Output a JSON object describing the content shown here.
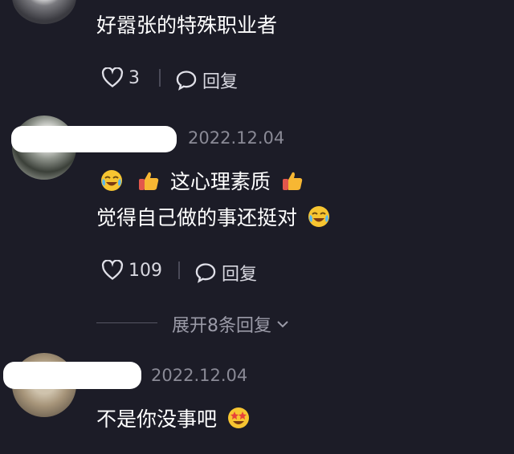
{
  "comments": [
    {
      "text": "好嚣张的特殊职业者",
      "likes": "3",
      "reply_label": "回复"
    },
    {
      "date": "2022.12.04",
      "text_line1": "这心理素质",
      "text_line2": "觉得自己做的事还挺对",
      "likes": "109",
      "reply_label": "回复",
      "expand_label": "展开8条回复"
    },
    {
      "date": "2022.12.04",
      "text": "不是你没事吧"
    }
  ],
  "icons": {
    "like": "heart-outline-icon",
    "reply": "speech-bubble-icon",
    "expand": "chevron-down-icon",
    "emoji_1": "crying-laughing-emoji",
    "emoji_2": "thumbs-up-emoji",
    "emoji_3": "star-struck-emoji"
  },
  "colors": {
    "background": "#1c1c27",
    "secondary_text": "#8a8a96"
  }
}
